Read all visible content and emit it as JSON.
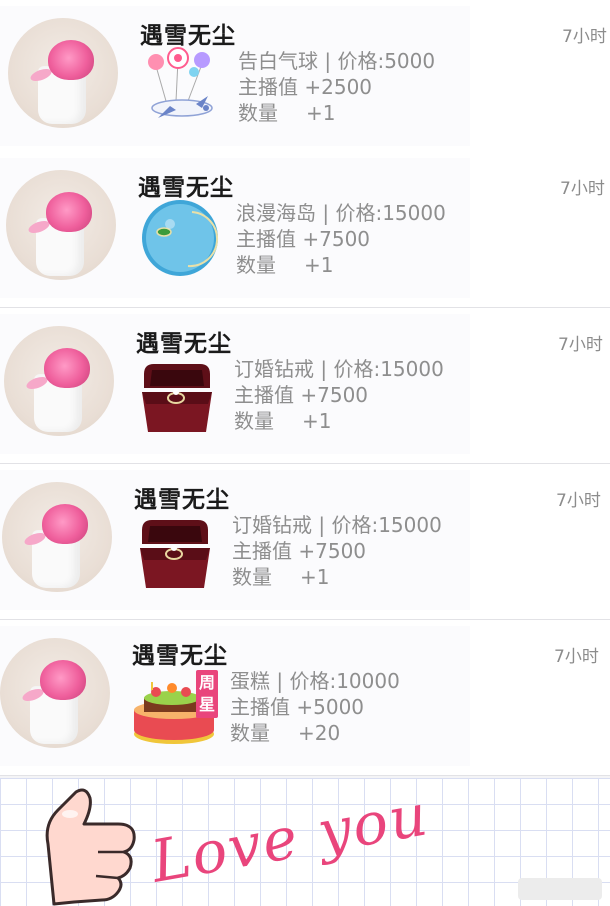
{
  "items": [
    {
      "user": "遇雪无尘",
      "time": "7小时",
      "gift": "告白气球 | 价格:5000",
      "score": "主播值 +2500",
      "qty_label": "数量",
      "qty": "+1",
      "gift_icon": "balloon-plane-icon"
    },
    {
      "user": "遇雪无尘",
      "time": "7小时",
      "gift": "浪漫海岛 | 价格:15000",
      "score": "主播值 +7500",
      "qty_label": "数量",
      "qty": "+1",
      "gift_icon": "island-icon"
    },
    {
      "user": "遇雪无尘",
      "time": "7小时",
      "gift": "订婚钻戒 | 价格:15000",
      "score": "主播值 +7500",
      "qty_label": "数量",
      "qty": "+1",
      "gift_icon": "ring-box-icon"
    },
    {
      "user": "遇雪无尘",
      "time": "7小时",
      "gift": "订婚钻戒 | 价格:15000",
      "score": "主播值 +7500",
      "qty_label": "数量",
      "qty": "+1",
      "gift_icon": "ring-box-icon"
    },
    {
      "user": "遇雪无尘",
      "time": "7小时",
      "gift": "蛋糕 | 价格:10000",
      "score": "主播值 +5000",
      "qty_label": "数量",
      "qty": "+20",
      "gift_icon": "cake-icon",
      "badge": "周星"
    }
  ],
  "sticker_text": "Love you",
  "colors": {
    "accent_pink": "#e9457c",
    "text_gray": "#8e8e8e"
  }
}
